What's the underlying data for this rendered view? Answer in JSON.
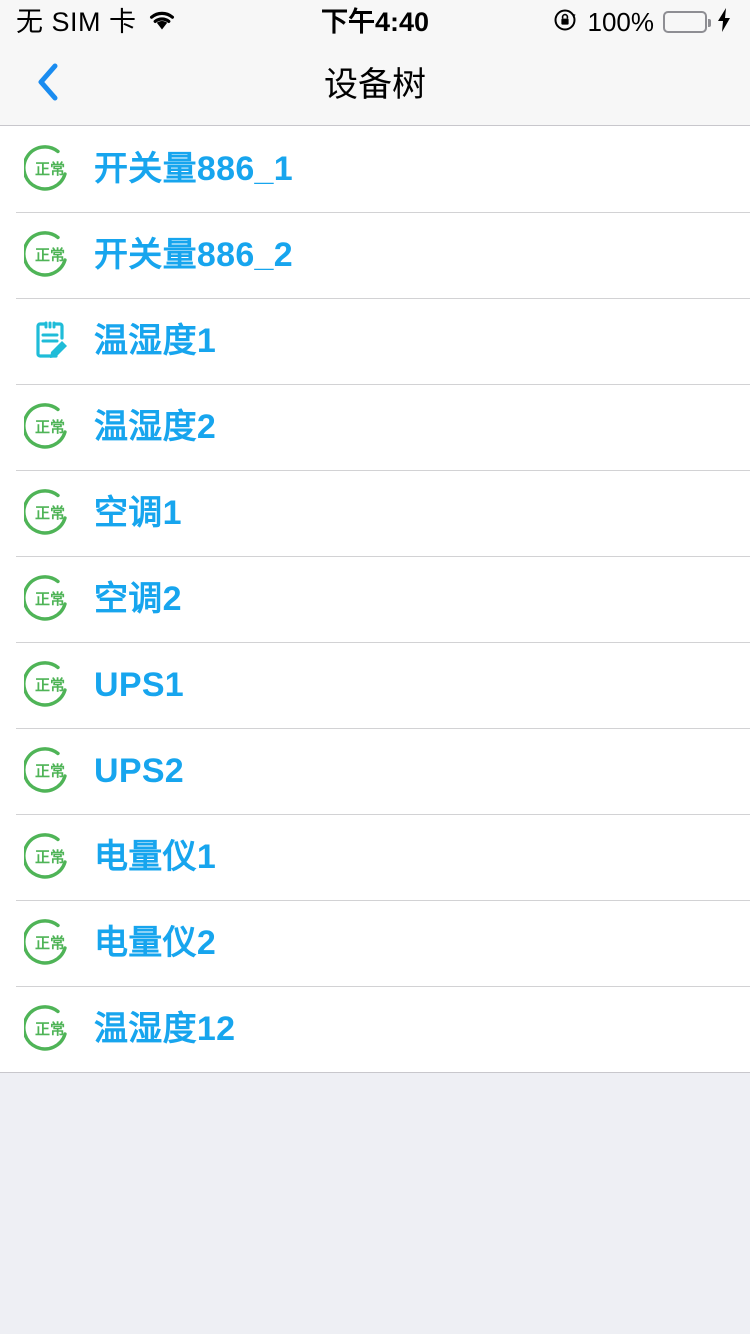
{
  "status_bar": {
    "carrier": "无 SIM 卡",
    "wifi_icon": "wifi-icon",
    "time": "下午4:40",
    "rotation_lock_icon": "rotation-lock-icon",
    "battery_percent": "100%",
    "battery_icon": "battery-full-icon",
    "charging_icon": "lightning-bolt-icon",
    "battery_color": "#4cd964"
  },
  "nav": {
    "back_icon": "chevron-left-icon",
    "title": "设备树",
    "back_color": "#1a8cf0"
  },
  "theme": {
    "label_blue": "#17a5ee",
    "status_green": "#4fb457",
    "note_cyan": "#1fbcd8",
    "page_background": "#eeeff4",
    "bar_background": "#f7f7f7",
    "separator": "#d2d2d4"
  },
  "list": {
    "rows": [
      {
        "label": "开关量886_1",
        "icon": "status-normal-icon",
        "status_text": "正常"
      },
      {
        "label": "开关量886_2",
        "icon": "status-normal-icon",
        "status_text": "正常"
      },
      {
        "label": "温湿度1",
        "icon": "note-edit-icon",
        "status_text": ""
      },
      {
        "label": "温湿度2",
        "icon": "status-normal-icon",
        "status_text": "正常"
      },
      {
        "label": "空调1",
        "icon": "status-normal-icon",
        "status_text": "正常"
      },
      {
        "label": "空调2",
        "icon": "status-normal-icon",
        "status_text": "正常"
      },
      {
        "label": "UPS1",
        "icon": "status-normal-icon",
        "status_text": "正常"
      },
      {
        "label": "UPS2",
        "icon": "status-normal-icon",
        "status_text": "正常"
      },
      {
        "label": "电量仪1",
        "icon": "status-normal-icon",
        "status_text": "正常"
      },
      {
        "label": "电量仪2",
        "icon": "status-normal-icon",
        "status_text": "正常"
      },
      {
        "label": "温湿度12",
        "icon": "status-normal-icon",
        "status_text": "正常"
      }
    ]
  }
}
